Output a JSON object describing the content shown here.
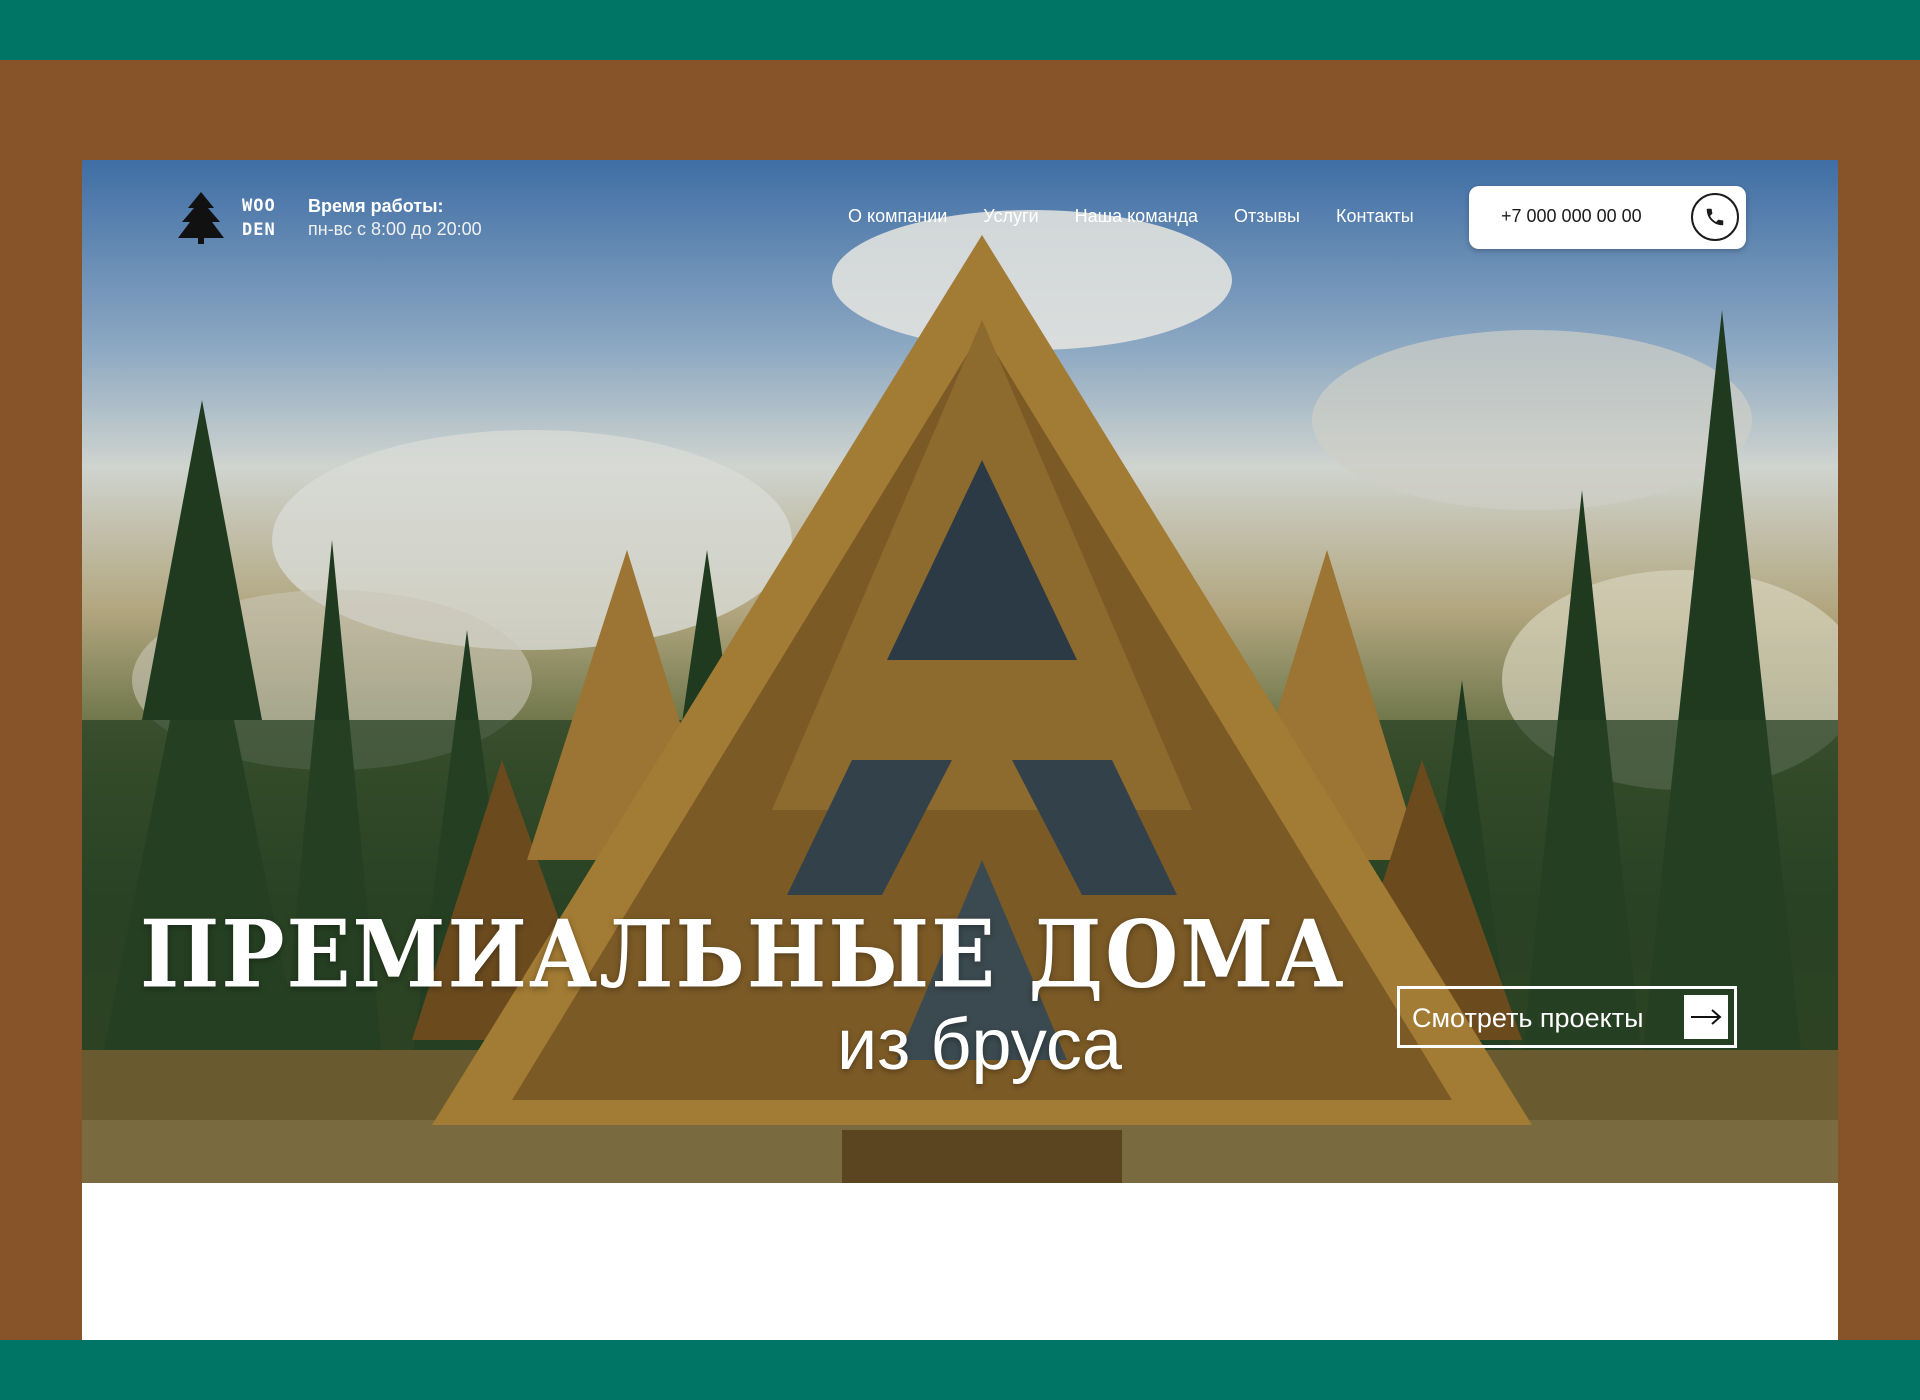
{
  "brand": {
    "logo_line1": "WOO",
    "logo_line2": "DEN"
  },
  "hours": {
    "title": "Время работы:",
    "value": "пн-вс с 8:00 до 20:00"
  },
  "nav": {
    "items": [
      "О компании",
      "Услуги",
      "Наша команда",
      "Отзывы",
      "Контакты"
    ]
  },
  "contact": {
    "phone": "+7 000 000 00 00"
  },
  "hero": {
    "title_line1": "ПРЕМИАЛЬНЫЕ ДОМА",
    "title_line2": "из бруса",
    "cta_label": "Смотреть проекты"
  },
  "colors": {
    "teal_stripe": "#007566",
    "brown_background": "#875429",
    "text_white": "#ffffff"
  },
  "icons": {
    "logo": "pine-tree-icon",
    "phone": "phone-icon",
    "cta": "arrow-right-icon"
  }
}
